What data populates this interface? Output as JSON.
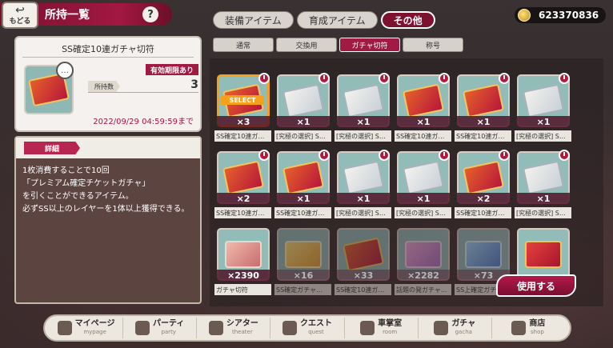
{
  "header": {
    "back_label": "もどる",
    "title": "所持一覧",
    "help": "?"
  },
  "main_tabs": [
    {
      "label": "装備アイテム",
      "active": false
    },
    {
      "label": "育成アイテム",
      "active": false
    },
    {
      "label": "その他",
      "active": true
    }
  ],
  "currency": {
    "value": "623370836",
    "icon": "coin-icon"
  },
  "sub_tabs": [
    {
      "label": "通常",
      "active": false
    },
    {
      "label": "交換用",
      "active": false
    },
    {
      "label": "ガチャ切符",
      "active": true
    },
    {
      "label": "称号",
      "active": false
    }
  ],
  "detail": {
    "name": "SS確定10連ガチャ切符",
    "expiry_badge": "有効期限あり",
    "qty_label": "所持数",
    "qty": "3",
    "expiry_date": "2022/09/29 04:59:59まで",
    "desc_tag": "詳細",
    "description": "1枚消費することで10回\n「プレミアム確定チケットガチャ」\nを引くことができるアイテム。\n必ずSS以上のレイヤーを1体以上獲得できる。"
  },
  "items": [
    {
      "name": "SS確定10連ガ…",
      "count": "×3",
      "ticket": "ss",
      "select": "SELECT",
      "timer": true,
      "faded": false
    },
    {
      "name": "[究極の選択] S…",
      "count": "×1",
      "ticket": "pick",
      "timer": true,
      "faded": false
    },
    {
      "name": "[究極の選択] S…",
      "count": "×1",
      "ticket": "pick",
      "timer": true,
      "faded": false
    },
    {
      "name": "SS確定10連ガ…",
      "count": "×1",
      "ticket": "ss",
      "timer": true,
      "faded": false
    },
    {
      "name": "SS確定10連ガ…",
      "count": "×1",
      "ticket": "ss",
      "timer": true,
      "faded": false
    },
    {
      "name": "[究極の選択] S…",
      "count": "×1",
      "ticket": "pick",
      "timer": true,
      "faded": false
    },
    {
      "name": "SS確定10連ガ…",
      "count": "×2",
      "ticket": "ss",
      "timer": true,
      "faded": false
    },
    {
      "name": "SS確定10連ガ…",
      "count": "×1",
      "ticket": "ss",
      "timer": true,
      "faded": false
    },
    {
      "name": "[究極の選択] S…",
      "count": "×1",
      "ticket": "pick",
      "timer": true,
      "faded": false
    },
    {
      "name": "[究極の選択] S…",
      "count": "×1",
      "ticket": "pick",
      "timer": true,
      "faded": false
    },
    {
      "name": "SS確定10連ガ…",
      "count": "×2",
      "ticket": "ss",
      "timer": true,
      "faded": false
    },
    {
      "name": "[究極の選択] S…",
      "count": "×1",
      "ticket": "pick",
      "timer": true,
      "faded": false
    },
    {
      "name": "ガチャ切符",
      "count": "×2390",
      "ticket": "gacha",
      "timer": false,
      "faded": false
    },
    {
      "name": "SS確定ガチャ…",
      "count": "×16",
      "ticket": "gold",
      "timer": false,
      "faded": true
    },
    {
      "name": "SS確定10連ガ…",
      "count": "×33",
      "ticket": "ss",
      "timer": false,
      "faded": true
    },
    {
      "name": "話題の発ガチャ…",
      "count": "×2282",
      "ticket": "purple",
      "timer": false,
      "faded": true
    },
    {
      "name": "SS上確定ガチ…",
      "count": "×73",
      "ticket": "blue",
      "timer": false,
      "faded": true
    },
    {
      "name": "",
      "count": "",
      "ticket": "envelope",
      "timer": false,
      "faded": false
    }
  ],
  "use_button": "使用する",
  "nav": [
    {
      "jp": "マイページ",
      "en": "mypage",
      "icon": "train-icon"
    },
    {
      "jp": "パーティ",
      "en": "party",
      "icon": "character-icon"
    },
    {
      "jp": "シアター",
      "en": "theater",
      "icon": "camera-icon"
    },
    {
      "jp": "クエスト",
      "en": "quest",
      "icon": "swords-icon"
    },
    {
      "jp": "車掌室",
      "en": "room",
      "icon": "pen-icon"
    },
    {
      "jp": "ガチャ",
      "en": "gacha",
      "icon": "ticket-icon"
    },
    {
      "jp": "商店",
      "en": "shop",
      "icon": "shopkeeper-icon"
    }
  ]
}
